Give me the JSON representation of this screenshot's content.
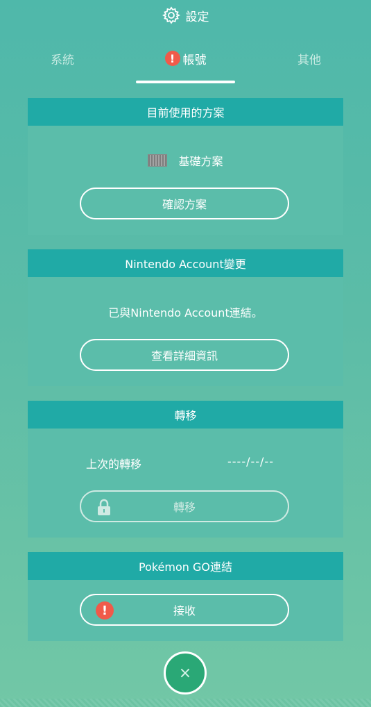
{
  "header": {
    "title": "設定",
    "icon": "gear-icon"
  },
  "tabs": [
    {
      "label": "系統",
      "active": false
    },
    {
      "label": "帳號",
      "active": true,
      "badge": "!"
    },
    {
      "label": "其他",
      "active": false
    }
  ],
  "plan_card": {
    "title": "目前使用的方案",
    "plan_name": "基礎方案",
    "confirm_label": "確認方案"
  },
  "account_card": {
    "title": "Nintendo Account變更",
    "status_text": "已與Nintendo Account連結。",
    "details_label": "查看詳細資訊"
  },
  "transfer_card": {
    "title": "轉移",
    "last_label": "上次的轉移",
    "last_value": "----/--/--",
    "transfer_label": "轉移"
  },
  "pokemon_card": {
    "title": "Pokémon GO連結",
    "receive_label": "接收",
    "badge": "!"
  },
  "close": {
    "symbol": "×"
  },
  "colors": {
    "card_header": "#20aaa6",
    "alert": "#f05a4a",
    "close_button": "#2aa876"
  }
}
